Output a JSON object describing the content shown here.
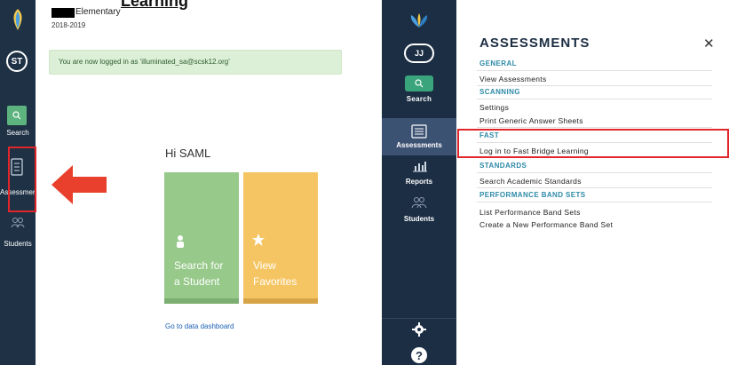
{
  "left": {
    "title_fragment": "Learning",
    "school_name": "Elementary",
    "school_year": "2018-2019",
    "user_initials": "ST",
    "nav": {
      "search": "Search",
      "assessments": "Assessments",
      "students": "Students"
    },
    "alert": "You are now logged in as 'illuminated_sa@scsk12.org'",
    "greeting": "Hi SAML",
    "cards": [
      {
        "line1": "Search for",
        "line2": "a Student"
      },
      {
        "line1": "View",
        "line2": "Favorites"
      }
    ],
    "dashboard_link": "Go to data dashboard"
  },
  "right": {
    "user_initials": "JJ",
    "nav": {
      "search": "Search",
      "assessments": "Assessments",
      "reports": "Reports",
      "students": "Students"
    },
    "panel_title": "ASSESSMENTS",
    "close_glyph": "✕",
    "sections": [
      {
        "heading": "GENERAL",
        "items": [
          "View Assessments"
        ]
      },
      {
        "heading": "SCANNING",
        "items": [
          "Settings",
          "Print Generic Answer Sheets"
        ]
      },
      {
        "heading": "FAST",
        "items": [
          "Log in to Fast Bridge Learning"
        ]
      },
      {
        "heading": "STANDARDS",
        "items": [
          "Search Academic Standards"
        ]
      },
      {
        "heading": "PERFORMANCE BAND SETS",
        "items": [
          "List Performance Band Sets",
          "Create a New Performance Band Set"
        ]
      }
    ],
    "help_glyph": "?"
  },
  "colors": {
    "sidebar": "#1e3145",
    "highlight": "#e0262b",
    "card_green": "#96c98a",
    "card_yellow": "#f6c563",
    "section_heading": "#2d8aa8"
  }
}
